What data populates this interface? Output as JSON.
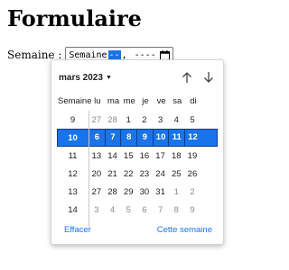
{
  "page": {
    "title": "Formulaire"
  },
  "field": {
    "label": "Semaine :",
    "segments": {
      "word": "Semaine",
      "week": "--",
      "sep": ", ",
      "year": "----"
    }
  },
  "calendar": {
    "month_label": "mars 2023",
    "week_header": "Semaine",
    "weekdays": [
      "lu",
      "ma",
      "me",
      "je",
      "ve",
      "sa",
      "di"
    ],
    "rows": [
      {
        "week": "9",
        "days": [
          "27",
          "28",
          "1",
          "2",
          "3",
          "4",
          "5"
        ],
        "other": [
          true,
          true,
          false,
          false,
          false,
          false,
          false
        ],
        "selected": false
      },
      {
        "week": "10",
        "days": [
          "6",
          "7",
          "8",
          "9",
          "10",
          "11",
          "12"
        ],
        "other": [
          false,
          false,
          false,
          false,
          false,
          false,
          false
        ],
        "selected": true
      },
      {
        "week": "11",
        "days": [
          "13",
          "14",
          "15",
          "16",
          "17",
          "18",
          "19"
        ],
        "other": [
          false,
          false,
          false,
          false,
          false,
          false,
          false
        ],
        "selected": false
      },
      {
        "week": "12",
        "days": [
          "20",
          "21",
          "22",
          "23",
          "24",
          "25",
          "26"
        ],
        "other": [
          false,
          false,
          false,
          false,
          false,
          false,
          false
        ],
        "selected": false
      },
      {
        "week": "13",
        "days": [
          "27",
          "28",
          "29",
          "30",
          "31",
          "1",
          "2"
        ],
        "other": [
          false,
          false,
          false,
          false,
          false,
          true,
          true
        ],
        "selected": false
      },
      {
        "week": "14",
        "days": [
          "3",
          "4",
          "5",
          "6",
          "7",
          "8",
          "9"
        ],
        "other": [
          true,
          true,
          true,
          true,
          true,
          true,
          true
        ],
        "selected": false
      }
    ],
    "clear_label": "Effacer",
    "this_week_label": "Cette semaine"
  },
  "icons": {
    "calendar": "calendar-icon",
    "month_dropdown": "caret-down-icon",
    "prev": "arrow-up-icon",
    "next": "arrow-down-icon"
  },
  "colors": {
    "accent": "#1a73e8",
    "accent_border": "#0b3d91",
    "muted": "#8a8a8a"
  }
}
